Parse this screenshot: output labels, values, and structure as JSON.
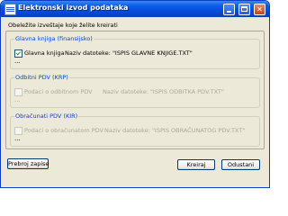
{
  "window": {
    "title": "Elektronski izvod podataka"
  },
  "intro": "Obeležite izveštaje koje želite kreirati",
  "sections": [
    {
      "legend": "Glavna knjiga (finansijsko)",
      "checkbox_label": "Glavna knjiga",
      "checked": true,
      "enabled": true,
      "file_label": "Naziv datoteke: \"ISPIS GLAVNE KNJIGE.TXT\"",
      "dots": "..."
    },
    {
      "legend": "Odbitni PDV (KRP)",
      "checkbox_label": "Podaci o odbitnom PDV",
      "checked": false,
      "enabled": false,
      "file_label": "Naziv datoteke: \"ISPIS ODBITKA PDV.TXT\"",
      "dots": "..."
    },
    {
      "legend": "Obračunati PDV (KIR)",
      "checkbox_label": "Podaci o obračunatom PDV",
      "checked": false,
      "enabled": false,
      "file_label": "Naziv datoteke: \"ISPIS OBRAČUNATOG PDV.TXT\"",
      "dots": "..."
    }
  ],
  "buttons": {
    "count": "Prebroj zapise",
    "create": "Kreiraj",
    "cancel": "Odustani"
  }
}
